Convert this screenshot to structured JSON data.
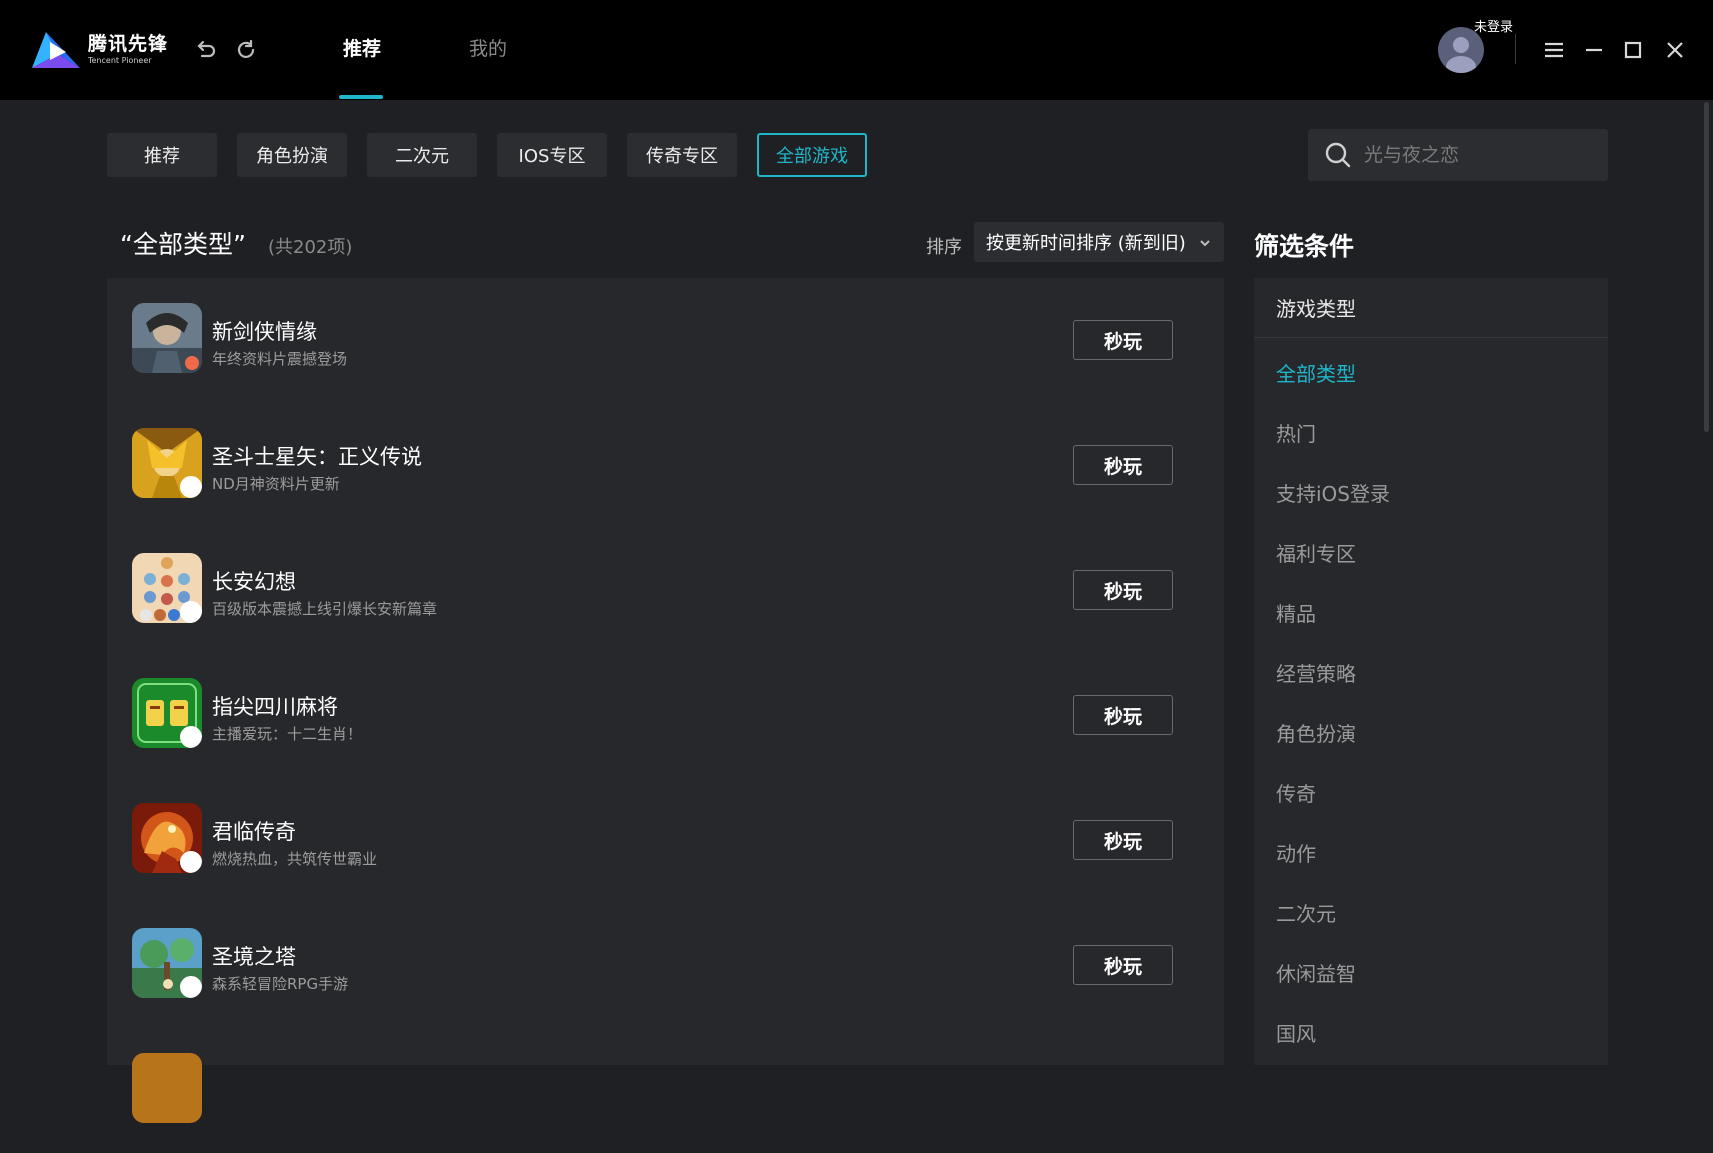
{
  "app": {
    "logo_cn": "腾讯先锋",
    "logo_en": "Tencent Pioneer",
    "brand_color": "#1fb6c9"
  },
  "nav": {
    "tabs": [
      {
        "label": "推荐",
        "active": true
      },
      {
        "label": "我的",
        "active": false
      }
    ]
  },
  "user": {
    "login_status": "未登录"
  },
  "categories": [
    {
      "label": "推荐",
      "active": false
    },
    {
      "label": "角色扮演",
      "active": false
    },
    {
      "label": "二次元",
      "active": false
    },
    {
      "label": "IOS专区",
      "active": false
    },
    {
      "label": "传奇专区",
      "active": false
    },
    {
      "label": "全部游戏",
      "active": true
    }
  ],
  "search": {
    "placeholder": "光与夜之恋"
  },
  "list": {
    "title": "“全部类型”",
    "count": "(共202项)",
    "sort_label": "排序",
    "sort_value": "按更新时间排序 (新到旧)",
    "play_label": "秒玩",
    "games": [
      {
        "name": "新剑侠情缘",
        "desc": "年终资料片震撼登场",
        "icon": "warrior-portrait"
      },
      {
        "name": "圣斗士星矢：正义传说",
        "desc": "ND月神资料片更新",
        "icon": "golden-saint"
      },
      {
        "name": "长安幻想",
        "desc": "百级版本震撼上线引爆长安新篇章",
        "icon": "chibi-characters"
      },
      {
        "name": "指尖四川麻将",
        "desc": "主播爱玩：十二生肖！",
        "icon": "mahjong-logo"
      },
      {
        "name": "君临传奇",
        "desc": "燃烧热血，共筑传世霸业",
        "icon": "fire-dragon"
      },
      {
        "name": "圣境之塔",
        "desc": "森系轻冒险RPG手游",
        "icon": "forest-scene"
      }
    ]
  },
  "filter": {
    "title": "筛选条件",
    "head": "游戏类型",
    "items": [
      {
        "label": "全部类型",
        "active": true
      },
      {
        "label": "热门",
        "active": false
      },
      {
        "label": "支持iOS登录",
        "active": false
      },
      {
        "label": "福利专区",
        "active": false
      },
      {
        "label": "精品",
        "active": false
      },
      {
        "label": "经营策略",
        "active": false
      },
      {
        "label": "角色扮演",
        "active": false
      },
      {
        "label": "传奇",
        "active": false
      },
      {
        "label": "动作",
        "active": false
      },
      {
        "label": "二次元",
        "active": false
      },
      {
        "label": "休闲益智",
        "active": false
      },
      {
        "label": "国风",
        "active": false
      }
    ]
  }
}
